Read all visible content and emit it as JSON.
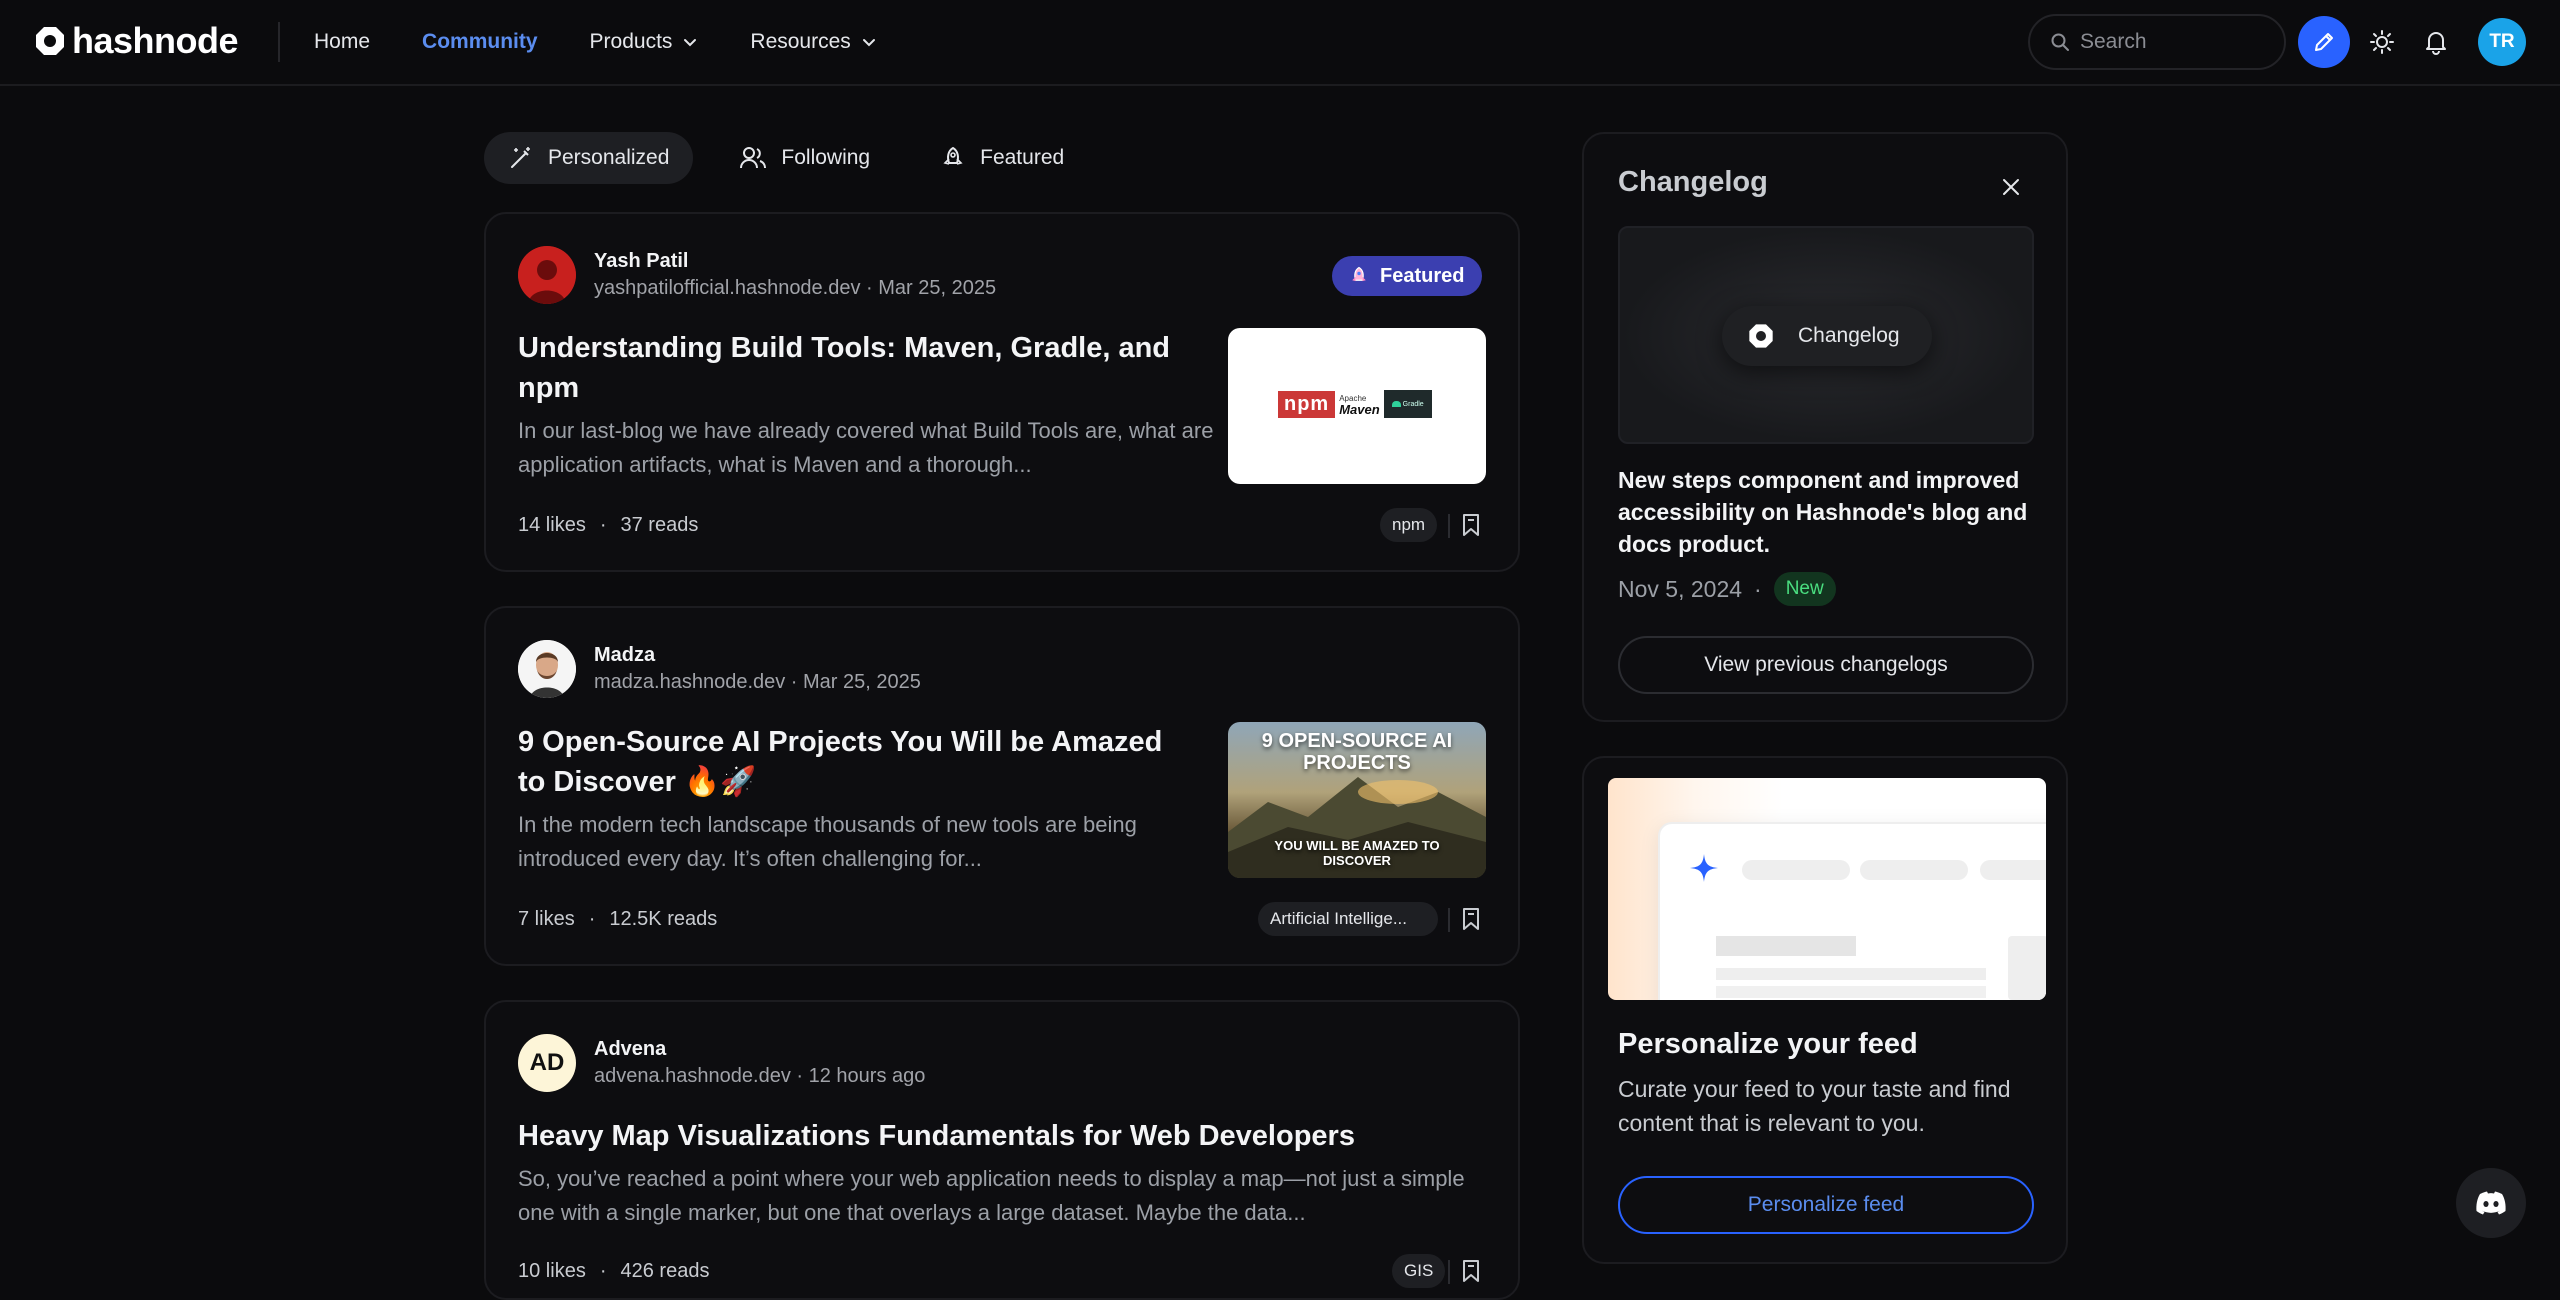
{
  "header": {
    "logo_text": "hashnode",
    "nav": [
      {
        "label": "Home"
      },
      {
        "label": "Community"
      },
      {
        "label": "Products"
      },
      {
        "label": "Resources"
      }
    ],
    "search_placeholder": "Search",
    "avatar_initials": "TR"
  },
  "tabs": [
    {
      "label": "Personalized"
    },
    {
      "label": "Following"
    },
    {
      "label": "Featured"
    }
  ],
  "posts": [
    {
      "author": "Yash Patil",
      "meta": "yashpatilofficial.hashnode.dev · Mar 25, 2025",
      "badge": "Featured",
      "title_line1": "Understanding Build Tools: Maven, Gradle, and",
      "title_line2": "npm",
      "excerpt": "In our last-blog we have already covered what Build Tools are, what are application artifacts, what is Maven and a thorough...",
      "likes": "14 likes",
      "reads": "37 reads",
      "tag": "npm",
      "thumb_texts": {
        "npm": "npm",
        "apache": "Apache",
        "maven": "Maven",
        "gradle": "Gradle"
      }
    },
    {
      "author": "Madza",
      "meta": "madza.hashnode.dev · Mar 25, 2025",
      "title_line1": "9 Open-Source AI Projects You Will be Amazed",
      "title_line2": "to Discover 🔥🚀",
      "excerpt": "In the modern tech landscape thousands of new tools are being introduced every day. It’s often challenging for...",
      "likes": "7 likes",
      "reads": "12.5K reads",
      "tag": "Artificial Intellige...",
      "thumb_texts": {
        "top1": "9 OPEN-SOURCE AI",
        "top2": "PROJECTS",
        "bottom1": "YOU WILL BE AMAZED TO",
        "bottom2": "DISCOVER"
      }
    },
    {
      "author": "Advena",
      "avatar_initials": "AD",
      "meta": "advena.hashnode.dev · 12 hours ago",
      "title_line1": "Heavy Map Visualizations Fundamentals for Web Developers",
      "excerpt": "So, you’ve reached a point where your web application needs to display a map—not just a simple one with a single marker, but one that overlays a large dataset. Maybe the data...",
      "likes": "10 likes",
      "reads": "426 reads",
      "tag": "GIS"
    }
  ],
  "changelog": {
    "title": "Changelog",
    "image_label": "Changelog",
    "headline": "New steps component and improved accessibility on Hashnode's blog and docs product.",
    "date": "Nov 5, 2024",
    "badge": "New",
    "button": "View previous changelogs"
  },
  "personalize": {
    "title": "Personalize your feed",
    "description": "Curate your feed to your taste and find content that is relevant to you.",
    "button": "Personalize feed"
  },
  "colors": {
    "accent": "#2962ff",
    "link": "#5b8def",
    "background": "#0b0b0d",
    "featured_badge": "#3b3fb0",
    "new_badge_text": "#4ade80"
  }
}
